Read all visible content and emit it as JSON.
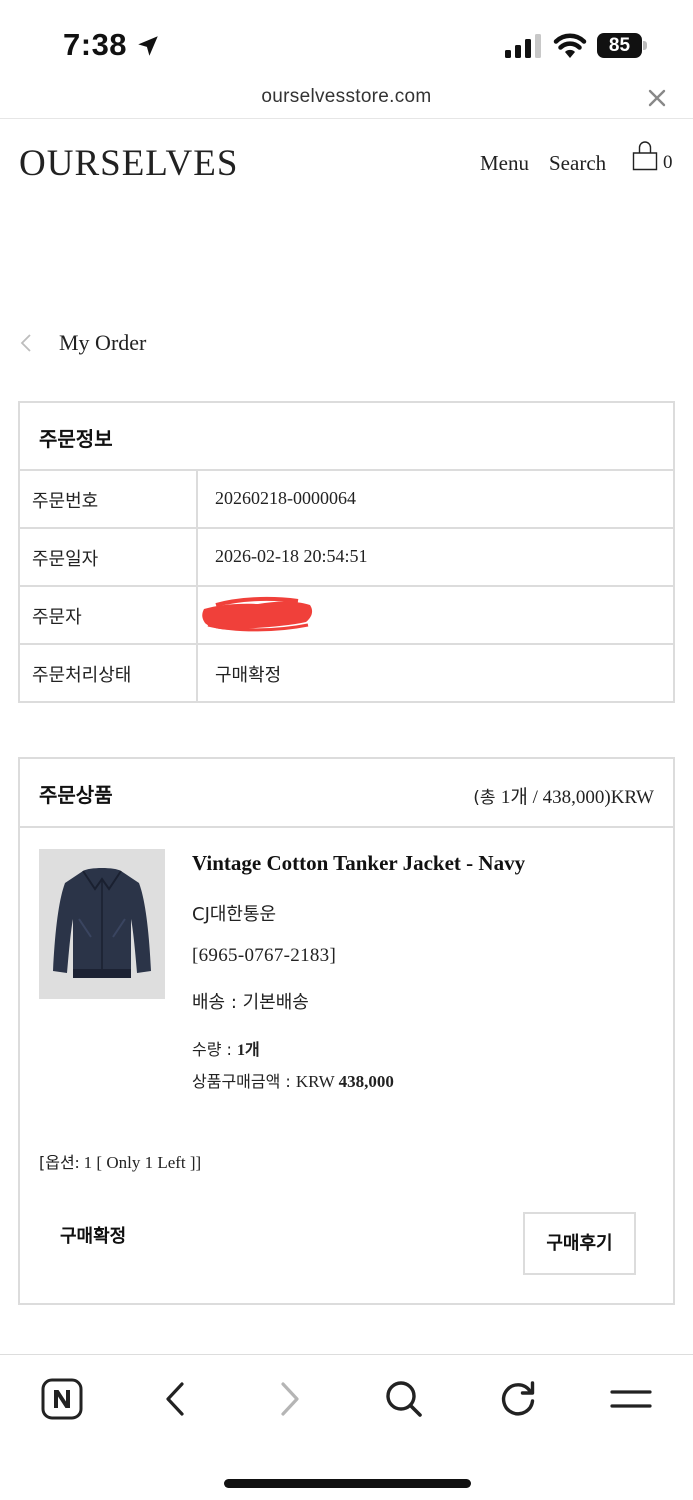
{
  "status_bar": {
    "time": "7:38",
    "battery": "85",
    "icons": [
      "location-arrow-icon",
      "signal-icon",
      "wifi-icon",
      "battery-icon"
    ]
  },
  "browser": {
    "url": "ourselvesstore.com",
    "close_icon": "close-icon"
  },
  "header": {
    "logo": "OURSELVES",
    "menu_label": "Menu",
    "search_label": "Search",
    "cart_icon": "shopping-bag-icon",
    "cart_count": "0"
  },
  "page": {
    "back_icon": "chevron-left-icon",
    "title": "My Order"
  },
  "order_info": {
    "title": "주문정보",
    "rows": [
      {
        "label": "주문번호",
        "value": "20260218-0000064"
      },
      {
        "label": "주문일자",
        "value": "2026-02-18 20:54:51"
      },
      {
        "label": "주문자",
        "value": ""
      },
      {
        "label": "주문처리상태",
        "value": "구매확정"
      }
    ]
  },
  "order_items": {
    "title": "주문상품",
    "summary_prefix": "(총 ",
    "summary_count": "1개",
    "summary_rest": " / 438,000)KRW",
    "product": {
      "name": "Vintage Cotton Tanker Jacket - Navy",
      "courier": "CJ대한통운",
      "tracking": "[6965-0767-2183]",
      "shipping": "배송 : 기본배송",
      "qty_label": "수량 : ",
      "qty_value": "1개",
      "price_label": "상품구매금액 : ",
      "price_currency": "KRW ",
      "price_value": "438,000",
      "option_label": "[옵션",
      "option_value": ": 1 [ Only 1 Left ]]",
      "status": "구매확정",
      "review_button": "구매후기"
    }
  },
  "toolbar": {
    "icons": [
      "naver-home-icon",
      "back-arrow-icon",
      "forward-arrow-icon",
      "search-icon",
      "refresh-icon",
      "menu-icon"
    ]
  },
  "colors": {
    "text": "#111111",
    "border": "#dcdcdc",
    "redaction": "#f0403a",
    "disabled": "#b5b5b5"
  }
}
